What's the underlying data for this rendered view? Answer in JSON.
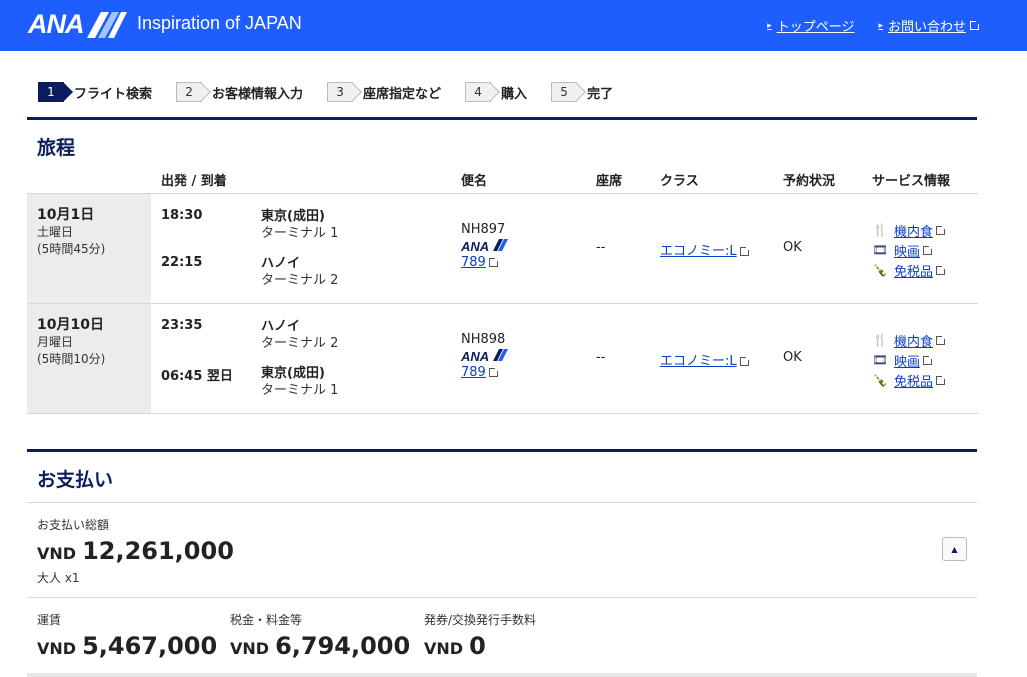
{
  "header": {
    "logo": "ANA",
    "tagline": "Inspiration of JAPAN",
    "links": [
      {
        "label": "トップページ",
        "external": false
      },
      {
        "label": "お問い合わせ",
        "external": true
      }
    ]
  },
  "steps": [
    {
      "num": "1",
      "label": "フライト検索",
      "active": true
    },
    {
      "num": "2",
      "label": "お客様情報入力"
    },
    {
      "num": "3",
      "label": "座席指定など"
    },
    {
      "num": "4",
      "label": "購入"
    },
    {
      "num": "5",
      "label": "完了"
    }
  ],
  "itinerary": {
    "title": "旅程",
    "headers": {
      "depart_arrive": "出発 / 到着",
      "flight": "便名",
      "seat": "座席",
      "class": "クラス",
      "status": "予約状況",
      "service": "サービス情報"
    },
    "rows": [
      {
        "date": "10月1日",
        "weekday": "土曜日",
        "duration": "(5時間45分)",
        "dep_time": "18:30",
        "dep_place": "東京(成田)",
        "dep_terminal": "ターミナル 1",
        "arr_time": "22:15",
        "arr_place": "ハノイ",
        "arr_terminal": "ターミナル 2",
        "flight_no": "NH897",
        "carrier": "ANA",
        "aircraft": "789",
        "seat": "--",
        "class": "エコノミー:L",
        "status": "OK",
        "services": [
          "機内食",
          "映画",
          "免税品"
        ]
      },
      {
        "date": "10月10日",
        "weekday": "月曜日",
        "duration": "(5時間10分)",
        "dep_time": "23:35",
        "dep_place": "ハノイ",
        "dep_terminal": "ターミナル 2",
        "arr_time": "06:45 翌日",
        "arr_place": "東京(成田)",
        "arr_terminal": "ターミナル 1",
        "flight_no": "NH898",
        "carrier": "ANA",
        "aircraft": "789",
        "seat": "--",
        "class": "エコノミー:L",
        "status": "OK",
        "services": [
          "機内食",
          "映画",
          "免税品"
        ]
      }
    ]
  },
  "payment": {
    "title": "お支払い",
    "total_label": "お支払い総額",
    "currency": "VND",
    "total": "12,261,000",
    "pax": "大人 x1",
    "fare_label": "運賃",
    "fare": "5,467,000",
    "tax_label": "税金・料金等",
    "tax": "6,794,000",
    "fee_label": "発券/交換発行手数料",
    "fee": "0"
  },
  "colors": {
    "brand_blue": "#1e5eff",
    "navy": "#0b1e5b",
    "link": "#0b3ec4"
  },
  "icons": {
    "meal": "fork-knife-icon",
    "movie": "film-reel-icon",
    "dutyfree": "bottles-icon",
    "external": "external-link-icon",
    "collapse": "caret-up-icon"
  }
}
